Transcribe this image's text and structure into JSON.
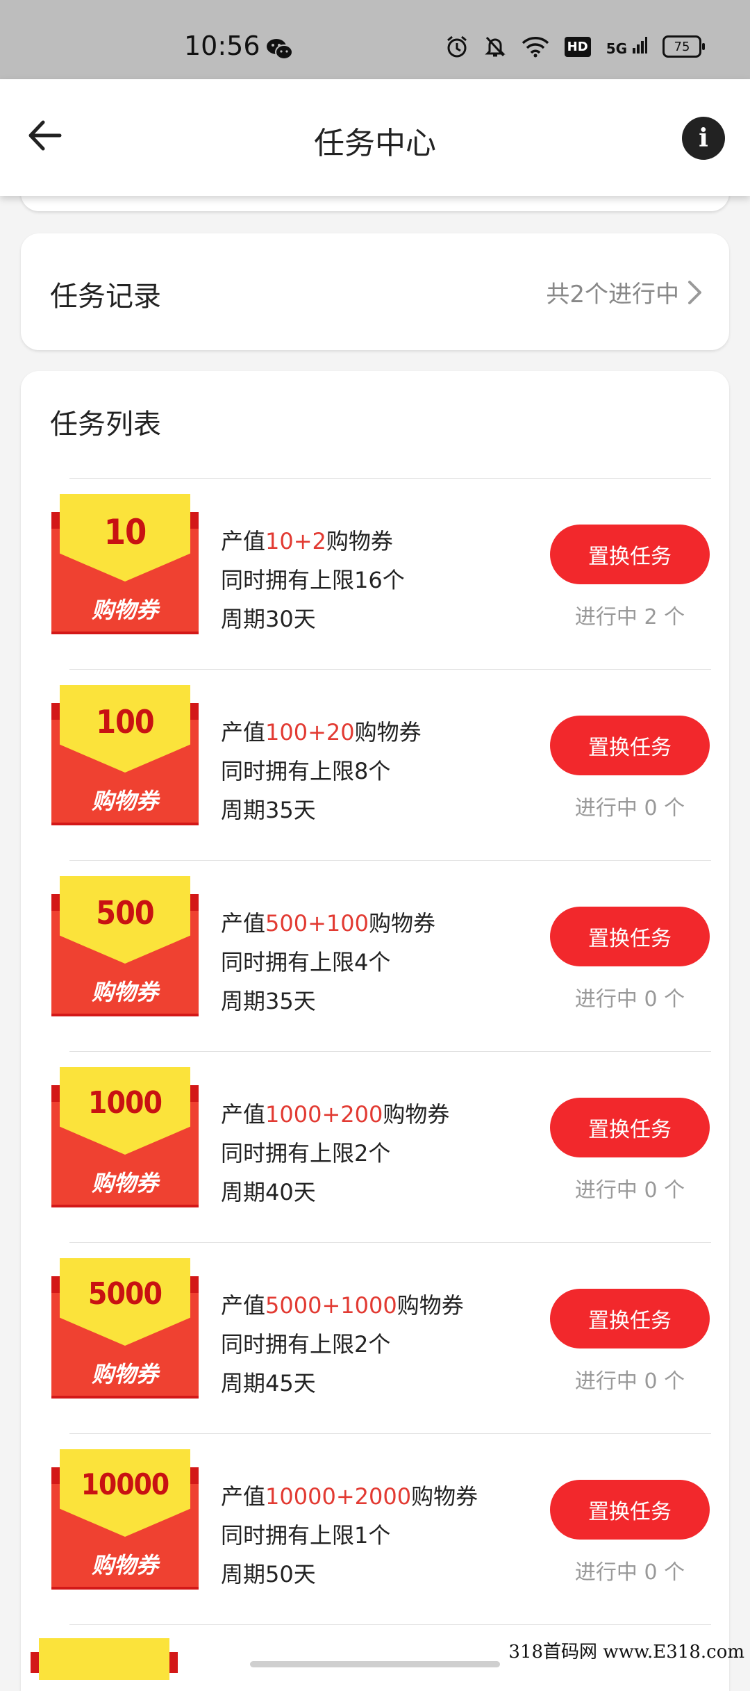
{
  "status_bar": {
    "time": "10:56",
    "network": "5G",
    "hd": "HD",
    "battery": "75"
  },
  "app_bar": {
    "title": "任务中心"
  },
  "record": {
    "label": "任务记录",
    "summary": "共2个进行中"
  },
  "list": {
    "title": "任务列表",
    "items": [
      {
        "coupon_value": "10",
        "coupon_word": "购物券",
        "desc_prefix": "产值",
        "desc_value": "10+2",
        "desc_suffix": "购物券",
        "limit": "同时拥有上限16个",
        "period": "周期30天",
        "button": "置换任务",
        "status": "进行中 2 个"
      },
      {
        "coupon_value": "100",
        "coupon_word": "购物券",
        "desc_prefix": "产值",
        "desc_value": "100+20",
        "desc_suffix": "购物券",
        "limit": "同时拥有上限8个",
        "period": "周期35天",
        "button": "置换任务",
        "status": "进行中 0 个"
      },
      {
        "coupon_value": "500",
        "coupon_word": "购物券",
        "desc_prefix": "产值",
        "desc_value": "500+100",
        "desc_suffix": "购物券",
        "limit": "同时拥有上限4个",
        "period": "周期35天",
        "button": "置换任务",
        "status": "进行中 0 个"
      },
      {
        "coupon_value": "1000",
        "coupon_word": "购物券",
        "desc_prefix": "产值",
        "desc_value": "1000+200",
        "desc_suffix": "购物券",
        "limit": "同时拥有上限2个",
        "period": "周期40天",
        "button": "置换任务",
        "status": "进行中 0 个"
      },
      {
        "coupon_value": "5000",
        "coupon_word": "购物券",
        "desc_prefix": "产值",
        "desc_value": "5000+1000",
        "desc_suffix": "购物券",
        "limit": "同时拥有上限2个",
        "period": "周期45天",
        "button": "置换任务",
        "status": "进行中 0 个"
      },
      {
        "coupon_value": "10000",
        "coupon_word": "购物券",
        "desc_prefix": "产值",
        "desc_value": "10000+2000",
        "desc_suffix": "购物券",
        "limit": "同时拥有上限1个",
        "period": "周期50天",
        "button": "置换任务",
        "status": "进行中 0 个"
      }
    ]
  },
  "watermark": "318首码网 www.E318.com",
  "colors": {
    "accent": "#f2282c",
    "highlight": "#e23a32",
    "coupon_red": "#ef4131",
    "coupon_yellow": "#fbe33b"
  }
}
